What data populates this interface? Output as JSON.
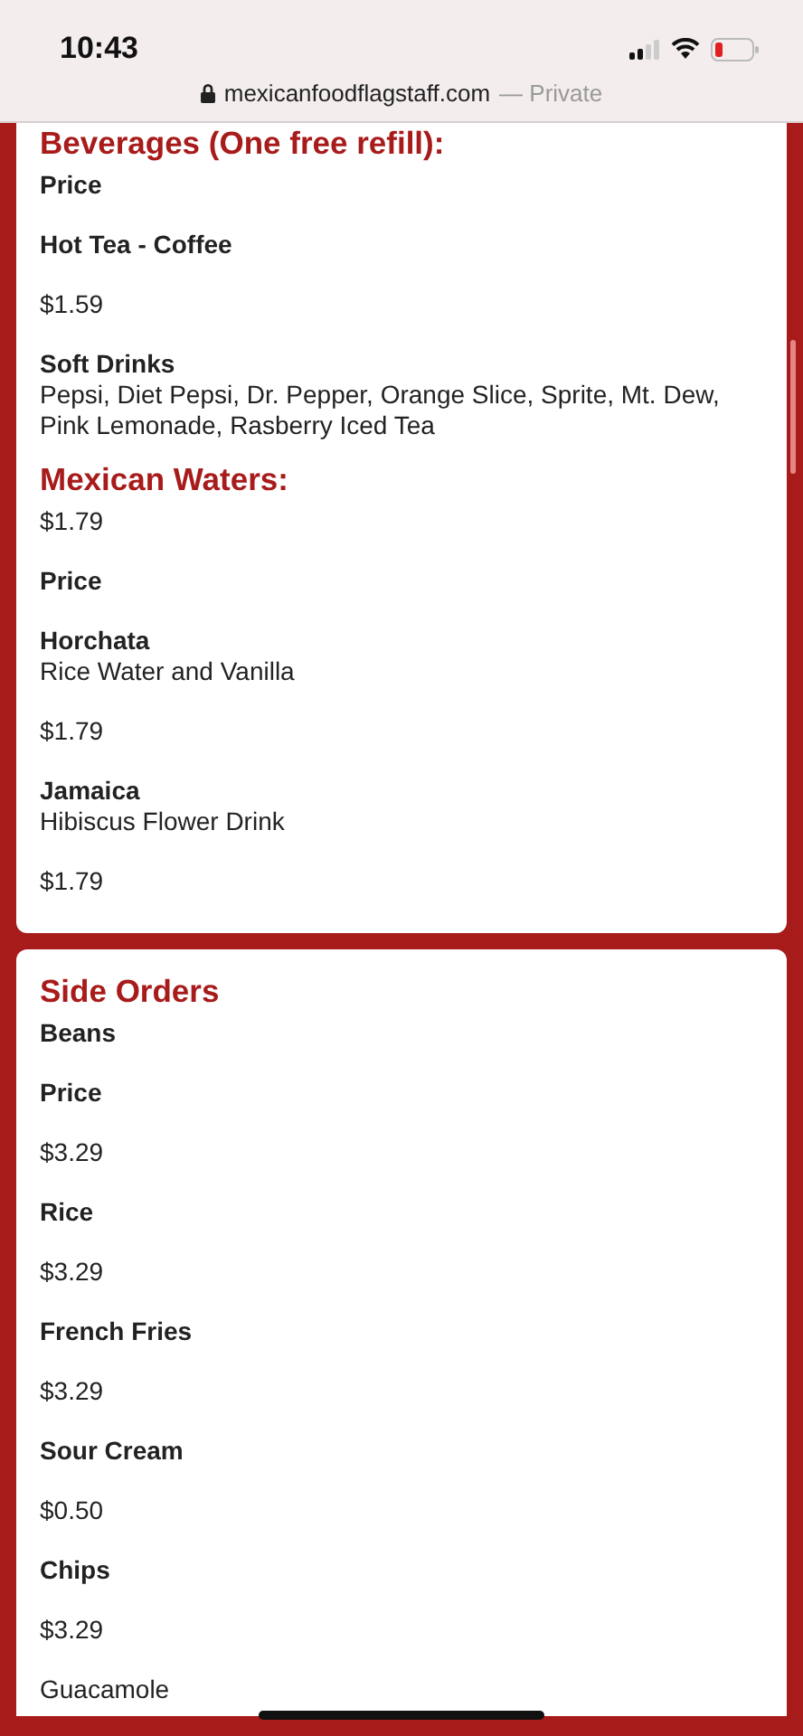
{
  "status_bar": {
    "time": "10:43"
  },
  "address_bar": {
    "domain": "mexicanfoodflagstaff.com",
    "mode": "— Private"
  },
  "cards": [
    {
      "groups": [
        {
          "heading": "Beverages (One free refill):",
          "blocks": [
            {
              "lines": [
                {
                  "kind": "name",
                  "text": "Price"
                }
              ]
            },
            {
              "lines": [
                {
                  "kind": "name",
                  "text": "Hot Tea - Coffee"
                }
              ]
            },
            {
              "lines": [
                {
                  "kind": "text",
                  "text": "$1.59"
                }
              ]
            },
            {
              "lines": [
                {
                  "kind": "name",
                  "text": "Soft Drinks"
                },
                {
                  "kind": "text",
                  "text": "Pepsi, Diet Pepsi, Dr. Pepper, Orange Slice, Sprite, Mt. Dew, Pink Lemonade, Rasberry Iced Tea"
                }
              ]
            }
          ]
        },
        {
          "heading": "Mexican Waters:",
          "blocks": [
            {
              "lines": [
                {
                  "kind": "text",
                  "text": "$1.79"
                }
              ]
            },
            {
              "lines": [
                {
                  "kind": "name",
                  "text": "Price"
                }
              ]
            },
            {
              "lines": [
                {
                  "kind": "name",
                  "text": "Horchata"
                },
                {
                  "kind": "text",
                  "text": "Rice Water and Vanilla"
                }
              ]
            },
            {
              "lines": [
                {
                  "kind": "text",
                  "text": "$1.79"
                }
              ]
            },
            {
              "lines": [
                {
                  "kind": "name",
                  "text": "Jamaica"
                },
                {
                  "kind": "text",
                  "text": "Hibiscus Flower Drink"
                }
              ]
            },
            {
              "lines": [
                {
                  "kind": "text",
                  "text": "$1.79"
                }
              ]
            }
          ]
        }
      ]
    },
    {
      "groups": [
        {
          "heading": "Side Orders",
          "blocks": [
            {
              "lines": [
                {
                  "kind": "name",
                  "text": "Beans"
                }
              ]
            },
            {
              "lines": [
                {
                  "kind": "name",
                  "text": "Price"
                }
              ]
            },
            {
              "lines": [
                {
                  "kind": "text",
                  "text": "$3.29"
                }
              ]
            },
            {
              "lines": [
                {
                  "kind": "name",
                  "text": "Rice"
                }
              ]
            },
            {
              "lines": [
                {
                  "kind": "text",
                  "text": "$3.29"
                }
              ]
            },
            {
              "lines": [
                {
                  "kind": "name",
                  "text": "French Fries"
                }
              ]
            },
            {
              "lines": [
                {
                  "kind": "text",
                  "text": "$3.29"
                }
              ]
            },
            {
              "lines": [
                {
                  "kind": "name",
                  "text": "Sour Cream"
                }
              ]
            },
            {
              "lines": [
                {
                  "kind": "text",
                  "text": "$0.50"
                }
              ]
            },
            {
              "lines": [
                {
                  "kind": "name",
                  "text": "Chips"
                }
              ]
            },
            {
              "lines": [
                {
                  "kind": "text",
                  "text": "$3.29"
                }
              ]
            },
            {
              "lines": [
                {
                  "kind": "text",
                  "text": "Guacamole"
                }
              ]
            }
          ]
        }
      ]
    }
  ]
}
